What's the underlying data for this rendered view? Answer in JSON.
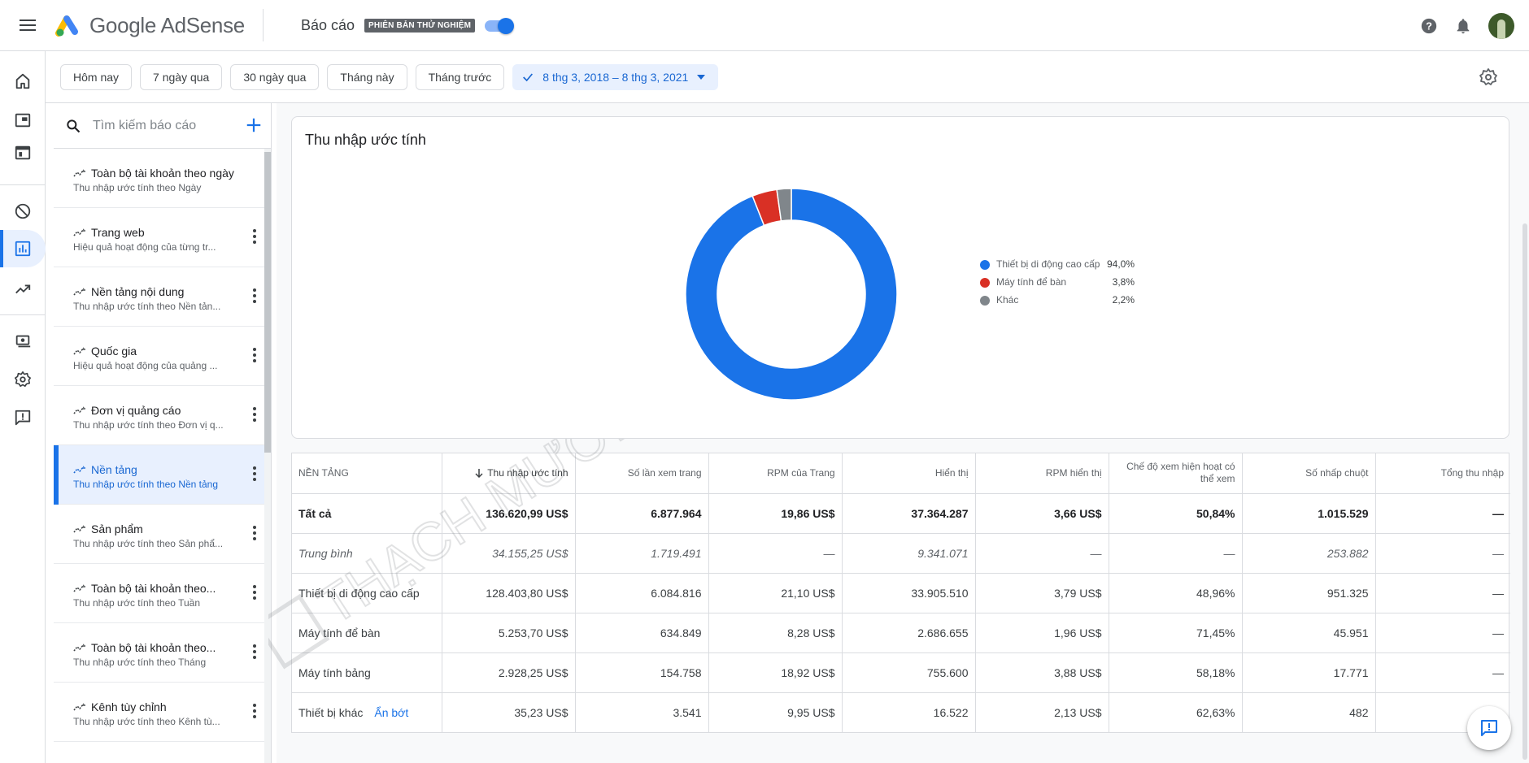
{
  "app": {
    "name": "Google AdSense",
    "page_title": "Báo cáo",
    "beta_badge": "PHIÊN BẢN THỬ NGHIỆM",
    "beta_toggle_on": true
  },
  "colors": {
    "accent": "#1a73e8",
    "mobile": "#1a73e8",
    "desktop": "#d93025",
    "other": "#80868b"
  },
  "date_filters": {
    "presets": [
      "Hôm nay",
      "7 ngày qua",
      "30 ngày qua",
      "Tháng này",
      "Tháng trước"
    ],
    "selected_range": "8 thg 3, 2018 – 8 thg 3, 2021"
  },
  "report_list": {
    "search_placeholder": "Tìm kiếm báo cáo",
    "items": [
      {
        "title": "Toàn bộ tài khoản theo ngày",
        "subtitle": "Thu nhập ước tính theo Ngày",
        "active": false,
        "menu": false
      },
      {
        "title": "Trang web",
        "subtitle": "Hiệu quả hoạt động của từng tr...",
        "active": false,
        "menu": true
      },
      {
        "title": "Nền tảng nội dung",
        "subtitle": "Thu nhập ước tính theo Nền tản...",
        "active": false,
        "menu": true
      },
      {
        "title": "Quốc gia",
        "subtitle": "Hiệu quả hoạt động của quảng ...",
        "active": false,
        "menu": true
      },
      {
        "title": "Đơn vị quảng cáo",
        "subtitle": "Thu nhập ước tính theo Đơn vị q...",
        "active": false,
        "menu": true
      },
      {
        "title": "Nền tảng",
        "subtitle": "Thu nhập ước tính theo Nền tảng",
        "active": true,
        "menu": true
      },
      {
        "title": "Sản phẩm",
        "subtitle": "Thu nhập ước tính theo Sản phẩ...",
        "active": false,
        "menu": true
      },
      {
        "title": "Toàn bộ tài khoản theo...",
        "subtitle": "Thu nhập ước tính theo Tuần",
        "active": false,
        "menu": true
      },
      {
        "title": "Toàn bộ tài khoản theo...",
        "subtitle": "Thu nhập ước tính theo Tháng",
        "active": false,
        "menu": true
      },
      {
        "title": "Kênh tùy chỉnh",
        "subtitle": "Thu nhập ước tính theo Kênh tù...",
        "active": false,
        "menu": true
      }
    ]
  },
  "card": {
    "title": "Thu nhập ước tính"
  },
  "chart_data": {
    "type": "pie",
    "title": "Thu nhập ước tính",
    "labels": [
      "Thiết bị di động cao cấp",
      "Máy tính để bàn",
      "Khác"
    ],
    "values": [
      94.0,
      3.8,
      2.2
    ],
    "value_labels": [
      "94,0%",
      "3,8%",
      "2,2%"
    ],
    "colors": [
      "#1a73e8",
      "#d93025",
      "#80868b"
    ],
    "donut": true,
    "legend": "right"
  },
  "table": {
    "sort_column": 1,
    "sort_direction": "desc",
    "headers": [
      "NỀN TẢNG",
      "Thu nhập ước tính",
      "Số lần xem trang",
      "RPM của Trang",
      "Hiển thị",
      "RPM hiển thị",
      "Chế độ xem hiện hoạt có thể xem",
      "Số nhấp chuột",
      "Tổng thu nhập"
    ],
    "rows": [
      {
        "kind": "total",
        "cells": [
          "Tất cả",
          "136.620,99 US$",
          "6.877.964",
          "19,86 US$",
          "37.364.287",
          "3,66 US$",
          "50,84%",
          "1.015.529",
          "—"
        ]
      },
      {
        "kind": "avg",
        "cells": [
          "Trung bình",
          "34.155,25 US$",
          "1.719.491",
          "—",
          "9.341.071",
          "—",
          "—",
          "253.882",
          "—"
        ]
      },
      {
        "kind": "row",
        "cells": [
          "Thiết bị di động cao cấp",
          "128.403,80 US$",
          "6.084.816",
          "21,10 US$",
          "33.905.510",
          "3,79 US$",
          "48,96%",
          "951.325",
          "—"
        ]
      },
      {
        "kind": "row",
        "cells": [
          "Máy tính để bàn",
          "5.253,70 US$",
          "634.849",
          "8,28 US$",
          "2.686.655",
          "1,96 US$",
          "71,45%",
          "45.951",
          "—"
        ]
      },
      {
        "kind": "row",
        "cells": [
          "Máy tính bảng",
          "2.928,25 US$",
          "154.758",
          "18,92 US$",
          "755.600",
          "3,88 US$",
          "58,18%",
          "17.771",
          "—"
        ]
      },
      {
        "kind": "row",
        "cells": [
          "Thiết bị khác",
          "35,23 US$",
          "3.541",
          "9,95 US$",
          "16.522",
          "2,13 US$",
          "62,63%",
          "482",
          ""
        ]
      }
    ],
    "hide_link": "Ẩn bớt"
  },
  "watermark": {
    "text": "THẠCH MƯỜI"
  }
}
